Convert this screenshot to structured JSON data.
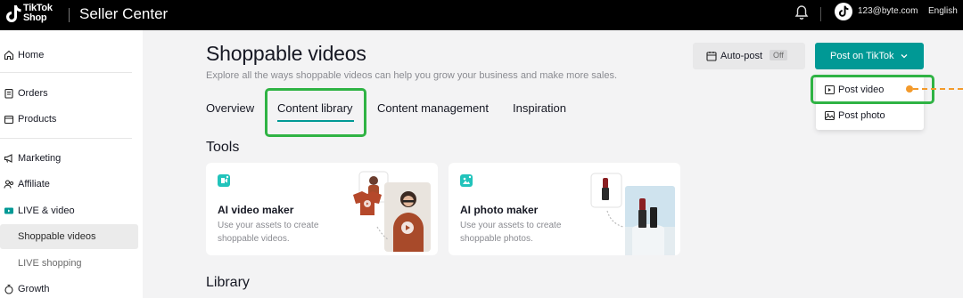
{
  "header": {
    "logo_line1": "TikTok",
    "logo_line2": "Shop",
    "title": "Seller Center",
    "email": "123@byte.com",
    "language": "English"
  },
  "sidebar": {
    "items": [
      {
        "label": "Home",
        "icon": "home-icon"
      },
      {
        "label": "Orders",
        "icon": "orders-icon"
      },
      {
        "label": "Products",
        "icon": "products-icon"
      },
      {
        "label": "Marketing",
        "icon": "megaphone-icon"
      },
      {
        "label": "Affiliate",
        "icon": "affiliate-icon"
      },
      {
        "label": "LIVE & video",
        "icon": "live-video-icon"
      },
      {
        "label": "Shoppable videos"
      },
      {
        "label": "LIVE shopping"
      },
      {
        "label": "Growth",
        "icon": "growth-icon"
      }
    ]
  },
  "main": {
    "title": "Shoppable videos",
    "subtitle": "Explore all the ways shoppable videos can help you grow your business and make more sales.",
    "tabs": [
      {
        "label": "Overview"
      },
      {
        "label": "Content library",
        "active": true
      },
      {
        "label": "Content management"
      },
      {
        "label": "Inspiration"
      }
    ],
    "tools_heading": "Tools",
    "library_heading": "Library",
    "cards": [
      {
        "title": "AI video maker",
        "desc": "Use your assets to create shoppable videos."
      },
      {
        "title": "AI photo maker",
        "desc": "Use your assets to create shoppable photos."
      }
    ]
  },
  "actions": {
    "autopost_label": "Auto-post",
    "autopost_state": "Off",
    "post_label": "Post on TikTok",
    "dropdown": [
      {
        "label": "Post video",
        "icon": "video-icon"
      },
      {
        "label": "Post photo",
        "icon": "photo-icon"
      }
    ]
  },
  "colors": {
    "accent": "#009995",
    "highlight": "#2fb344",
    "annotation": "#f39a2b"
  }
}
